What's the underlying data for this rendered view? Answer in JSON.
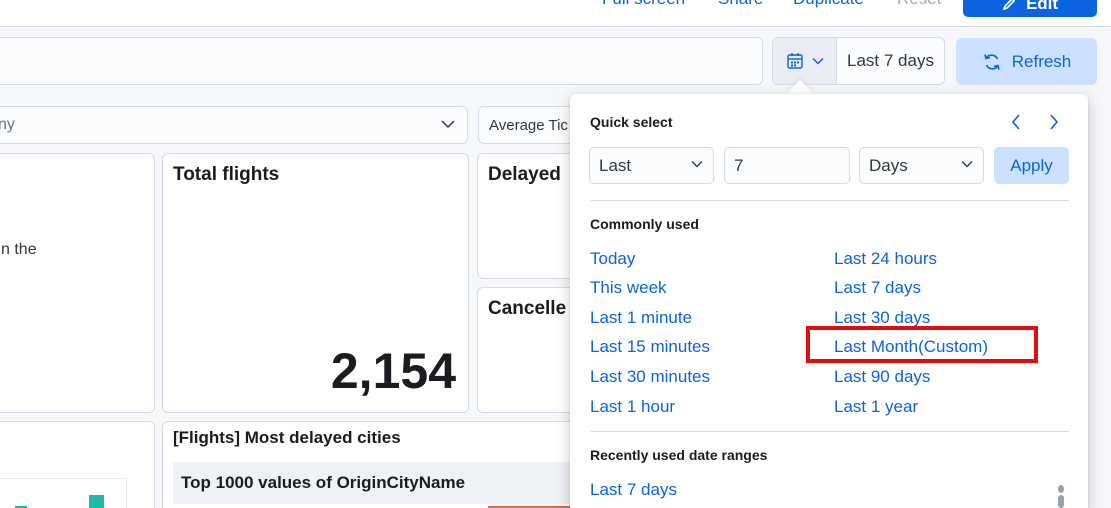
{
  "header": {
    "links": [
      "Full screen",
      "Share",
      "Duplicate",
      "Reset"
    ],
    "edit_label": "Edit"
  },
  "datepicker": {
    "label": "Last 7 days"
  },
  "refresh_label": "Refresh",
  "filters": {
    "company_placeholder": "ny",
    "ticket_price_label": "Average Tic"
  },
  "panels": {
    "intro_text": "n the",
    "total_flights_title": "Total flights",
    "total_flights_value": "2,154",
    "delayed_title": "Delayed",
    "cancelled_title": "Cancelle",
    "delayed_cities_title": "[Flights] Most delayed cities",
    "delayed_cities_column": "Top 1000 values of OriginCityName"
  },
  "quick_select": {
    "title": "Quick select",
    "direction": "Last",
    "amount": "7",
    "unit": "Days",
    "apply_label": "Apply"
  },
  "commonly_used": {
    "title": "Commonly used",
    "left": [
      "Today",
      "This week",
      "Last 1 minute",
      "Last 15 minutes",
      "Last 30 minutes",
      "Last 1 hour"
    ],
    "right": [
      "Last 24 hours",
      "Last 7 days",
      "Last 30 days",
      "Last Month(Custom)",
      "Last 90 days",
      "Last 1 year"
    ]
  },
  "recently_used": {
    "title": "Recently used date ranges",
    "items": [
      "Last 7 days"
    ]
  },
  "colors": {
    "link": "#0b64dd",
    "highlight": "#e00f0f",
    "accent_fill": "#cce1ff"
  }
}
